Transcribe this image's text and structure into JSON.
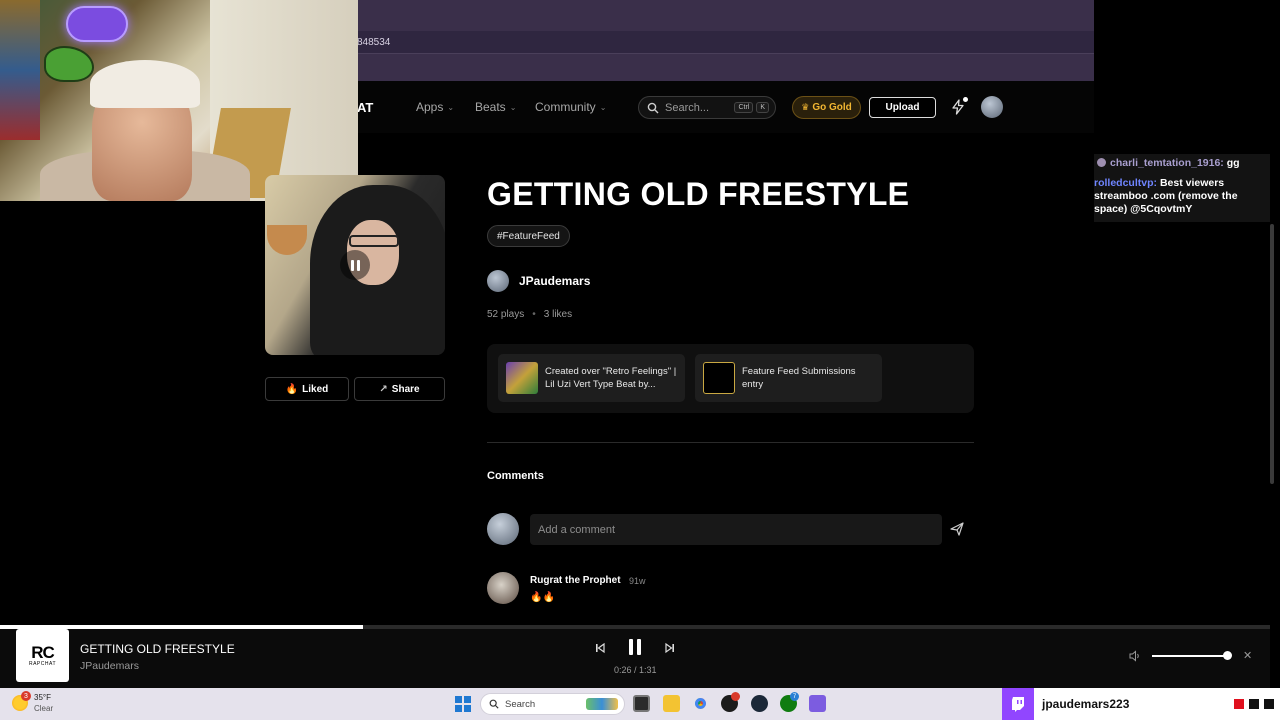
{
  "browser": {
    "url_fragment": "848534"
  },
  "header": {
    "logo_tail": "AT",
    "nav": [
      {
        "label": "Apps"
      },
      {
        "label": "Beats"
      },
      {
        "label": "Community"
      }
    ],
    "search": {
      "placeholder": "Search...",
      "shortcut_keys": [
        "Ctrl",
        "K"
      ]
    },
    "gold_label": "Go Gold",
    "upload_label": "Upload"
  },
  "track": {
    "title": "GETTING OLD FREESTYLE",
    "tag": "#FeatureFeed",
    "author": "JPaudemars",
    "plays": "52 plays",
    "likes": "3 likes",
    "liked_label": "Liked",
    "share_label": "Share"
  },
  "related": [
    {
      "text": "Created over \"Retro Feelings\" | Lil Uzi Vert Type Beat by..."
    },
    {
      "text": "Feature Feed Submissions entry"
    }
  ],
  "comments": {
    "title": "Comments",
    "input_placeholder": "Add a comment",
    "items": [
      {
        "author": "Rugrat the Prophet",
        "time": "91w",
        "body": "🔥🔥"
      }
    ]
  },
  "chat": [
    {
      "user": "charli_temtation_1916:",
      "message": "gg"
    },
    {
      "user": "rolledcultvp:",
      "message": "Best viewers streamboo .com (remove the space) @5CqovtmY"
    }
  ],
  "player": {
    "art_logo": "RC",
    "art_sub": "RAPCHAT",
    "title": "GETTING OLD FREESTYLE",
    "artist": "JPaudemars",
    "time": "0:26 / 1:31",
    "progress": 0.286,
    "volume": 0.93
  },
  "taskbar": {
    "weather_badge": "3",
    "temp": "35°F",
    "condition": "Clear",
    "search_placeholder": "Search",
    "xbox_badge": "7"
  },
  "twitch": {
    "username": "jpaudemars223"
  },
  "colors": {
    "gold": "#f2b632",
    "twitch_purple": "#9146ff",
    "chat_user1": "#a99fcf",
    "chat_user2": "#6f85ff"
  }
}
